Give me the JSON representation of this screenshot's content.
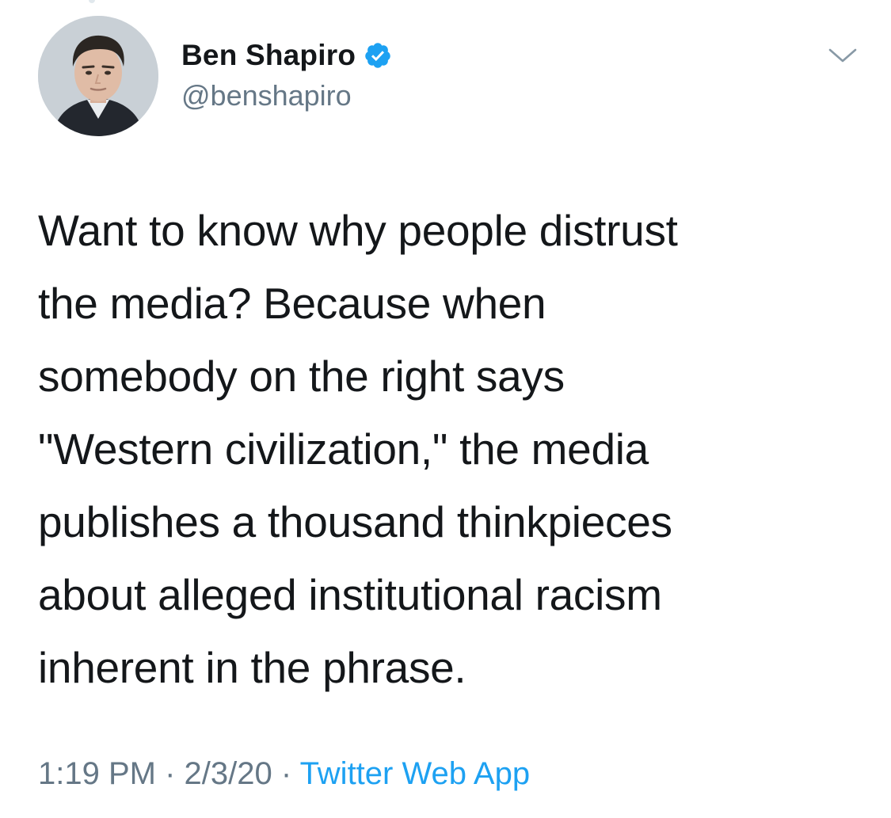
{
  "author": {
    "name": "Ben Shapiro",
    "handle": "@benshapiro",
    "verified": true,
    "avatar_icon": "profile-photo"
  },
  "menu": {
    "icon": "chevron-down-icon"
  },
  "tweet": {
    "text": "Want to know why people distrust\nthe media? Because when\nsomebody on the right says\n\"Western civilization,\" the media\npublishes a thousand thinkpieces\nabout alleged institutional racism\ninherent in the phrase."
  },
  "meta": {
    "time": "1:19 PM",
    "separator1": " · ",
    "date": "2/3/20",
    "separator2": " · ",
    "source": "Twitter Web App"
  },
  "colors": {
    "text": "#14171a",
    "secondary": "#657786",
    "accent": "#1da1f2",
    "background": "#ffffff"
  }
}
